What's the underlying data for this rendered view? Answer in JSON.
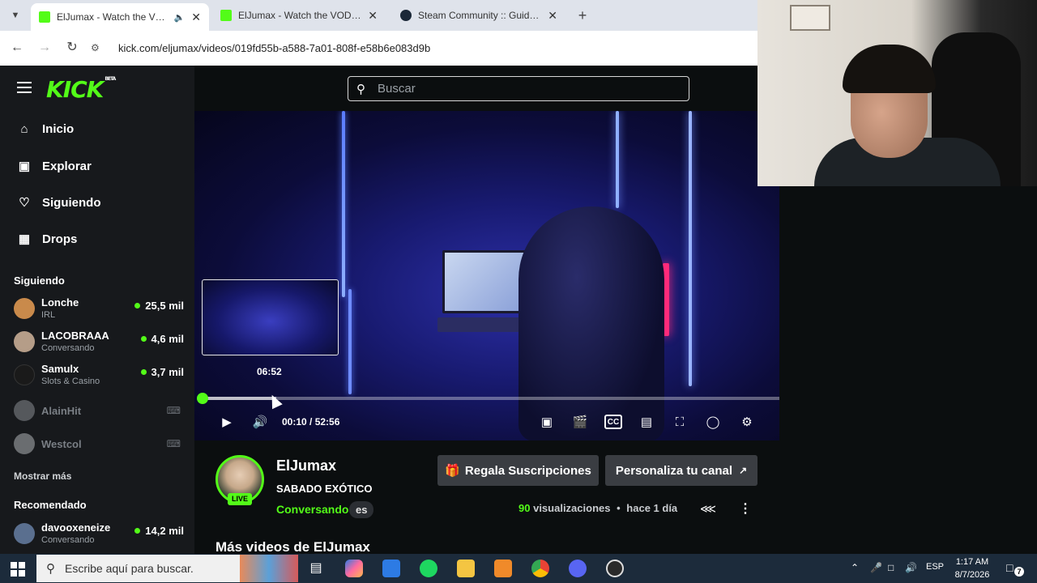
{
  "browser": {
    "tabs": [
      {
        "title": "ElJumax - Watch the VOD o",
        "active": true,
        "audio": true
      },
      {
        "title": "ElJumax - Watch the VOD on Ki",
        "active": false
      },
      {
        "title": "Steam Community :: Guide :: Co",
        "active": false
      }
    ],
    "url": "kick.com/eljumax/videos/019fd55b-a588-7a01-808f-e58b6e083d9b"
  },
  "kick": {
    "logo": "KICK",
    "logo_badge": "BETA",
    "search_placeholder": "Buscar",
    "nav": [
      {
        "label": "Inicio",
        "icon": "home-icon"
      },
      {
        "label": "Explorar",
        "icon": "compass-icon"
      },
      {
        "label": "Siguiendo",
        "icon": "heart-icon"
      },
      {
        "label": "Drops",
        "icon": "drops-icon"
      }
    ],
    "following_title": "Siguiendo",
    "following": [
      {
        "name": "Lonche",
        "category": "IRL",
        "viewers": "25,5 mil",
        "online": true,
        "color": "#c98a4b"
      },
      {
        "name": "LACOBRAAA",
        "category": "Conversando",
        "viewers": "4,6 mil",
        "online": true,
        "color": "#b59d88"
      },
      {
        "name": "Samulx",
        "category": "Slots & Casino",
        "viewers": "3,7 mil",
        "online": true,
        "color": "#1a1a1a"
      },
      {
        "name": "AlainHit",
        "online": false,
        "color": "#55585c"
      },
      {
        "name": "Westcol",
        "online": false,
        "color": "#6a6d70"
      }
    ],
    "show_more": "Mostrar más",
    "recommended_title": "Recomendado",
    "recommended": [
      {
        "name": "davooxeneize",
        "category": "Conversando",
        "viewers": "14,2 mil",
        "color": "#5a6f8f"
      }
    ],
    "player": {
      "preview_time": "06:52",
      "current_time": "00:10",
      "duration": "52:56",
      "time_display": "00:10 / 52:56",
      "progress_fraction": 0.003,
      "hover_fraction": 0.13
    },
    "channel": {
      "name": "ElJumax",
      "live_badge": "LIVE",
      "video_title": "SABADO EXÓTICO",
      "category": "Conversando",
      "language": "es",
      "views": "90",
      "views_label": "visualizaciones",
      "separator": "•",
      "age": "hace 1 día"
    },
    "buttons": {
      "gift": "Regala Suscripciones",
      "customize": "Personaliza tu canal"
    },
    "more_videos": "Más videos de ElJumax"
  },
  "taskbar": {
    "search_placeholder": "Escribe aquí para buscar.",
    "language": "ESP",
    "time": "1:17 AM",
    "date": "8/7/2026",
    "notifications": "7"
  },
  "colors": {
    "kick_green": "#53fc18",
    "background": "#0b0e0f",
    "sidebar": "#17191c"
  }
}
